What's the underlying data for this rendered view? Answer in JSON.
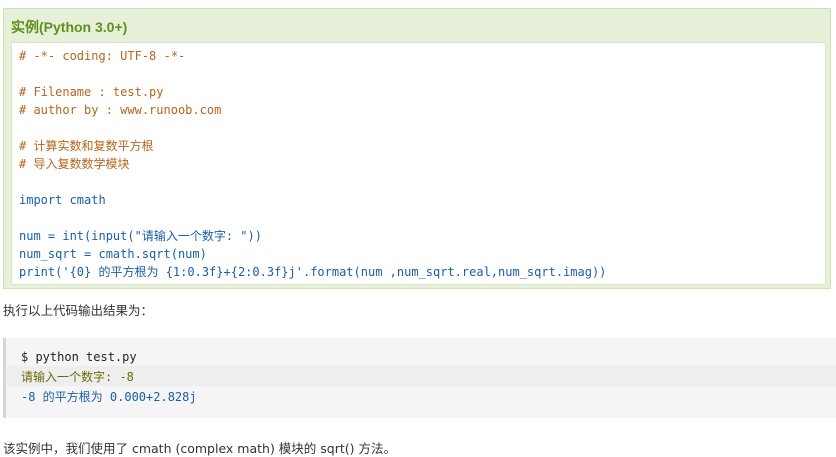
{
  "example": {
    "title": "实例(Python 3.0+)",
    "code_lines": [
      {
        "text": "# -*- coding: UTF-8 -*-",
        "kind": "comment"
      },
      {
        "text": "",
        "kind": "blank"
      },
      {
        "text": "# Filename : test.py",
        "kind": "comment"
      },
      {
        "text": "# author by : www.runoob.com",
        "kind": "comment"
      },
      {
        "text": "",
        "kind": "blank"
      },
      {
        "text": "# 计算实数和复数平方根",
        "kind": "comment"
      },
      {
        "text": "# 导入复数数学模块",
        "kind": "comment"
      },
      {
        "text": "",
        "kind": "blank"
      },
      {
        "text": "import cmath",
        "kind": "keyword"
      },
      {
        "text": "",
        "kind": "blank"
      },
      {
        "text": "num = int(input(\"请输入一个数字: \"))",
        "kind": "plain"
      },
      {
        "text": "num_sqrt = cmath.sqrt(num)",
        "kind": "plain"
      },
      {
        "text": "print('{0} 的平方根为 {1:0.3f}+{2:0.3f}j'.format(num ,num_sqrt.real,num_sqrt.imag))",
        "kind": "plain"
      }
    ]
  },
  "paragraph1": "执行以上代码输出结果为：",
  "output": {
    "command": "$ python test.py",
    "prompt_line": "请输入一个数字: -8",
    "result_line": "-8 的平方根为 0.000+2.828j"
  },
  "paragraph2": "该实例中，我们使用了 cmath (complex math) 模块的 sqrt() 方法。",
  "colors": {
    "title_green": "#5f8f1c",
    "box_bg": "#e7f1d9",
    "comment": "#b7651b",
    "code_blue": "#1b5fa7"
  }
}
